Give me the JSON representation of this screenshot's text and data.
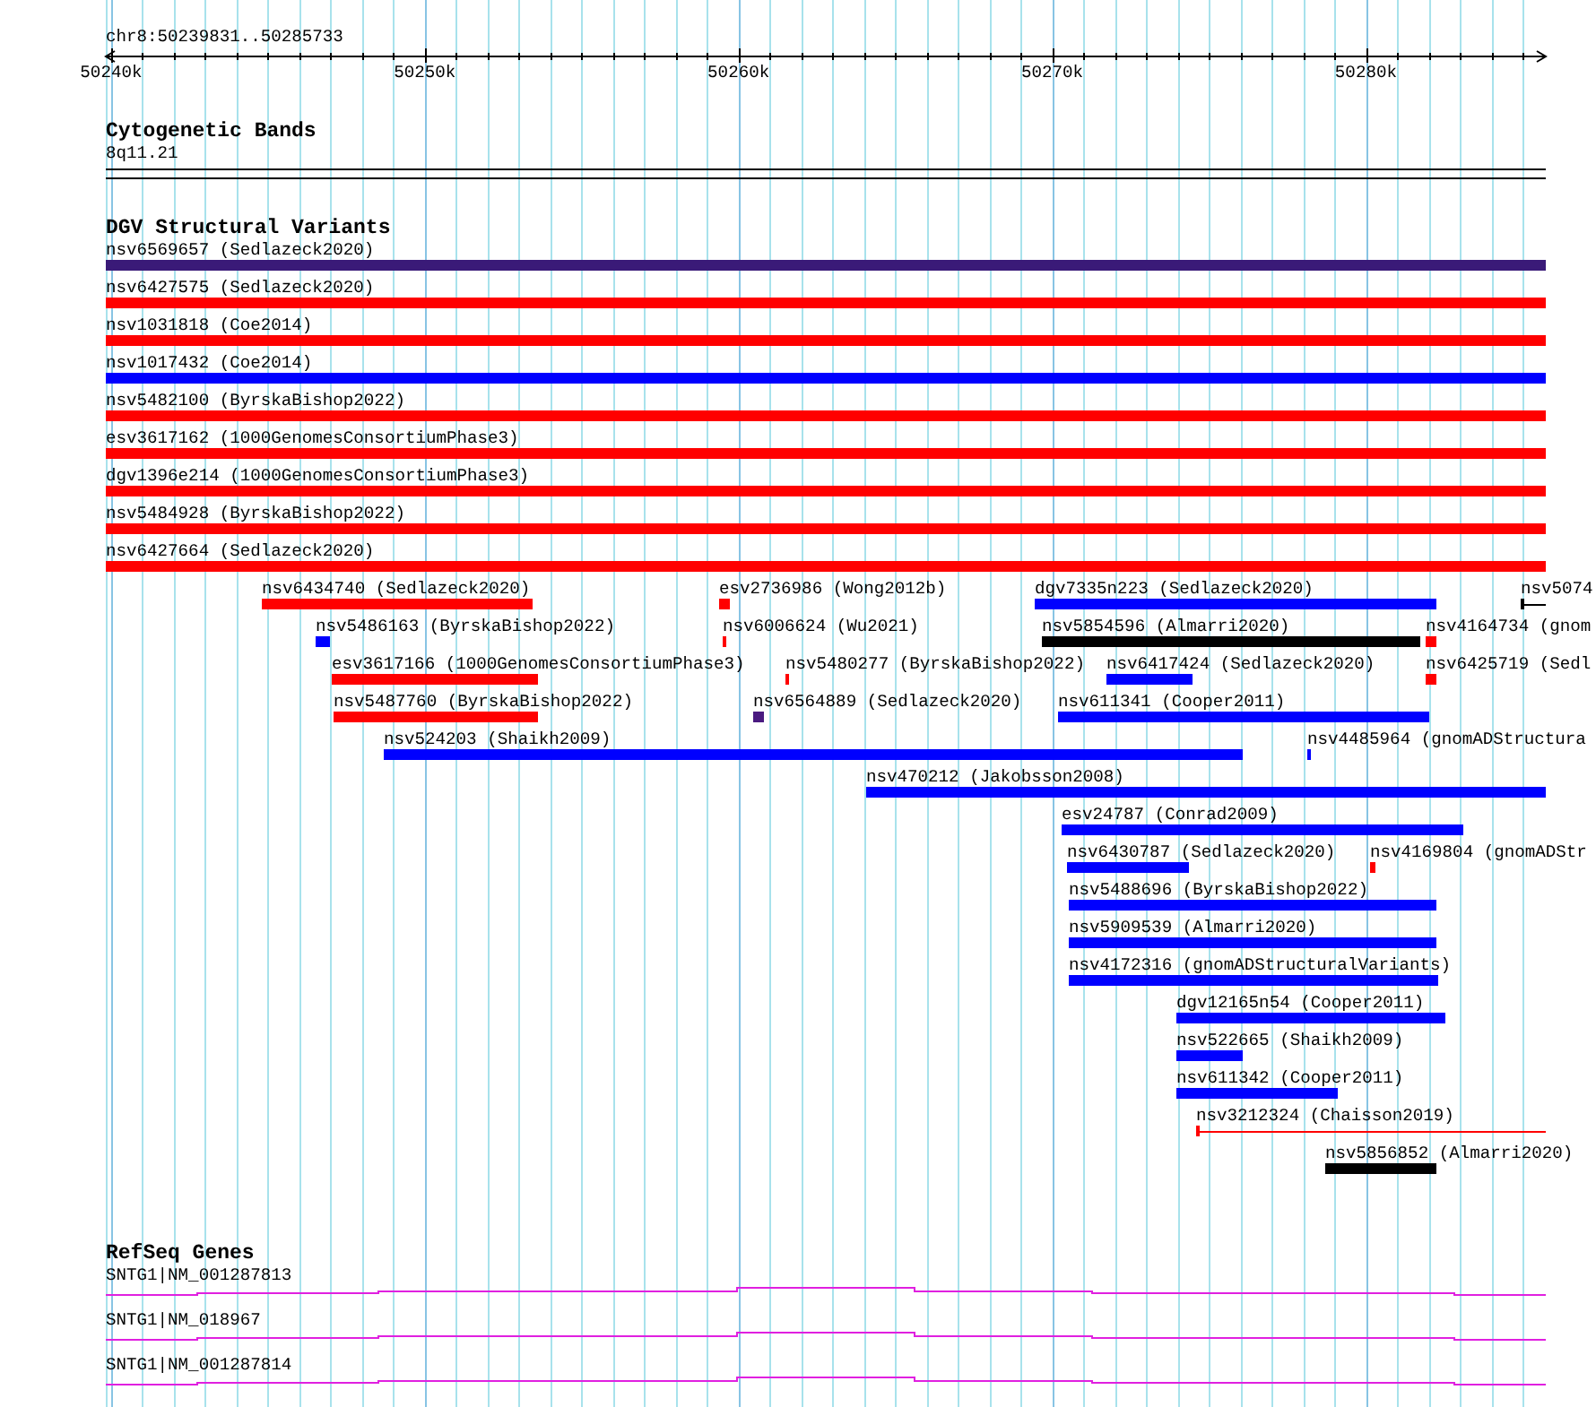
{
  "ruler": {
    "range": "chr8:50239831..50285733",
    "ticks": [
      {
        "label": "50240k"
      },
      {
        "label": "50250k"
      },
      {
        "label": "50260k"
      },
      {
        "label": "50270k"
      },
      {
        "label": "50280k"
      }
    ]
  },
  "cytogenetic_bands": {
    "title": "Cytogenetic Bands",
    "band": "8q11.21"
  },
  "dgv_structural_variants": {
    "title": "DGV Structural Variants",
    "rows": [
      {
        "features": [
          {
            "label": "nsv6569657 (Sedlazeck2020)",
            "kind": "block",
            "color": "#3a1a78"
          }
        ]
      },
      {
        "features": [
          {
            "label": "nsv6427575 (Sedlazeck2020)",
            "kind": "block",
            "color": "#ff0000"
          }
        ]
      },
      {
        "features": [
          {
            "label": "nsv1031818 (Coe2014)",
            "kind": "block",
            "color": "#ff0000"
          }
        ]
      },
      {
        "features": [
          {
            "label": "nsv1017432 (Coe2014)",
            "kind": "block",
            "color": "#0000ff"
          }
        ]
      },
      {
        "features": [
          {
            "label": "nsv5482100 (ByrskaBishop2022)",
            "kind": "block",
            "color": "#ff0000"
          }
        ]
      },
      {
        "features": [
          {
            "label": "esv3617162 (1000GenomesConsortiumPhase3)",
            "kind": "block",
            "color": "#ff0000"
          }
        ]
      },
      {
        "features": [
          {
            "label": "dgv1396e214 (1000GenomesConsortiumPhase3)",
            "kind": "block",
            "color": "#ff0000"
          }
        ]
      },
      {
        "features": [
          {
            "label": "nsv5484928 (ByrskaBishop2022)",
            "kind": "block",
            "color": "#ff0000"
          }
        ]
      },
      {
        "features": [
          {
            "label": "nsv6427664 (Sedlazeck2020)",
            "kind": "block",
            "color": "#ff0000"
          }
        ]
      },
      {
        "features": [
          {
            "label": "nsv6434740 (Sedlazeck2020)",
            "kind": "block",
            "color": "#ff0000"
          },
          {
            "label": "esv2736986 (Wong2012b)",
            "kind": "block",
            "color": "#ff0000"
          },
          {
            "label": "dgv7335n223 (Sedlazeck2020)",
            "kind": "block",
            "color": "#0000ff"
          },
          {
            "label": "nsv5074",
            "kind": "line",
            "color": "#000000"
          }
        ]
      },
      {
        "features": [
          {
            "label": "nsv5486163 (ByrskaBishop2022)",
            "kind": "block",
            "color": "#0000ff"
          },
          {
            "label": "nsv6006624 (Wu2021)",
            "kind": "block",
            "color": "#ff0000"
          },
          {
            "label": "nsv5854596 (Almarri2020)",
            "kind": "block",
            "color": "#000000"
          },
          {
            "label": "nsv4164734 (gnom",
            "kind": "block",
            "color": "#ff0000"
          }
        ]
      },
      {
        "features": [
          {
            "label": "esv3617166 (1000GenomesConsortiumPhase3)",
            "kind": "block",
            "color": "#ff0000"
          },
          {
            "label": "nsv5480277 (ByrskaBishop2022)",
            "kind": "block",
            "color": "#ff0000"
          },
          {
            "label": "nsv6417424 (Sedlazeck2020)",
            "kind": "block",
            "color": "#0000ff"
          },
          {
            "label": "nsv6425719 (Sedl",
            "kind": "block",
            "color": "#ff0000"
          }
        ]
      },
      {
        "features": [
          {
            "label": "nsv5487760 (ByrskaBishop2022)",
            "kind": "block",
            "color": "#ff0000"
          },
          {
            "label": "nsv6564889 (Sedlazeck2020)",
            "kind": "block",
            "color": "#4a1a80"
          },
          {
            "label": "nsv611341 (Cooper2011)",
            "kind": "block",
            "color": "#0000ff"
          }
        ]
      },
      {
        "features": [
          {
            "label": "nsv524203 (Shaikh2009)",
            "kind": "block",
            "color": "#0000ff"
          },
          {
            "label": "nsv4485964 (gnomADStructura",
            "kind": "block",
            "color": "#0000ff"
          }
        ]
      },
      {
        "features": [
          {
            "label": "nsv470212 (Jakobsson2008)",
            "kind": "block",
            "color": "#0000ff"
          }
        ]
      },
      {
        "features": [
          {
            "label": "esv24787 (Conrad2009)",
            "kind": "block",
            "color": "#0000ff"
          }
        ]
      },
      {
        "features": [
          {
            "label": "nsv6430787 (Sedlazeck2020)",
            "kind": "block",
            "color": "#0000ff"
          },
          {
            "label": "nsv4169804 (gnomADStr",
            "kind": "block",
            "color": "#ff0000"
          }
        ]
      },
      {
        "features": [
          {
            "label": "nsv5488696 (ByrskaBishop2022)",
            "kind": "block",
            "color": "#0000ff"
          }
        ]
      },
      {
        "features": [
          {
            "label": "nsv5909539 (Almarri2020)",
            "kind": "block",
            "color": "#0000ff"
          }
        ]
      },
      {
        "features": [
          {
            "label": "nsv4172316 (gnomADStructuralVariants)",
            "kind": "block",
            "color": "#0000ff"
          }
        ]
      },
      {
        "features": [
          {
            "label": "dgv12165n54 (Cooper2011)",
            "kind": "block",
            "color": "#0000ff"
          }
        ]
      },
      {
        "features": [
          {
            "label": "nsv522665 (Shaikh2009)",
            "kind": "block",
            "color": "#0000ff"
          }
        ]
      },
      {
        "features": [
          {
            "label": "nsv611342 (Cooper2011)",
            "kind": "block",
            "color": "#0000ff"
          }
        ]
      },
      {
        "features": [
          {
            "label": "nsv3212324 (Chaisson2019)",
            "kind": "line",
            "color": "#ff0000"
          }
        ]
      },
      {
        "features": [
          {
            "label": "nsv5856852 (Almarri2020)",
            "kind": "block",
            "color": "#000000"
          }
        ]
      }
    ]
  },
  "refseq_genes": {
    "title": "RefSeq Genes",
    "genes": [
      {
        "label": "SNTG1|NM_001287813"
      },
      {
        "label": "SNTG1|NM_018967"
      },
      {
        "label": "SNTG1|NM_001287814"
      }
    ]
  }
}
